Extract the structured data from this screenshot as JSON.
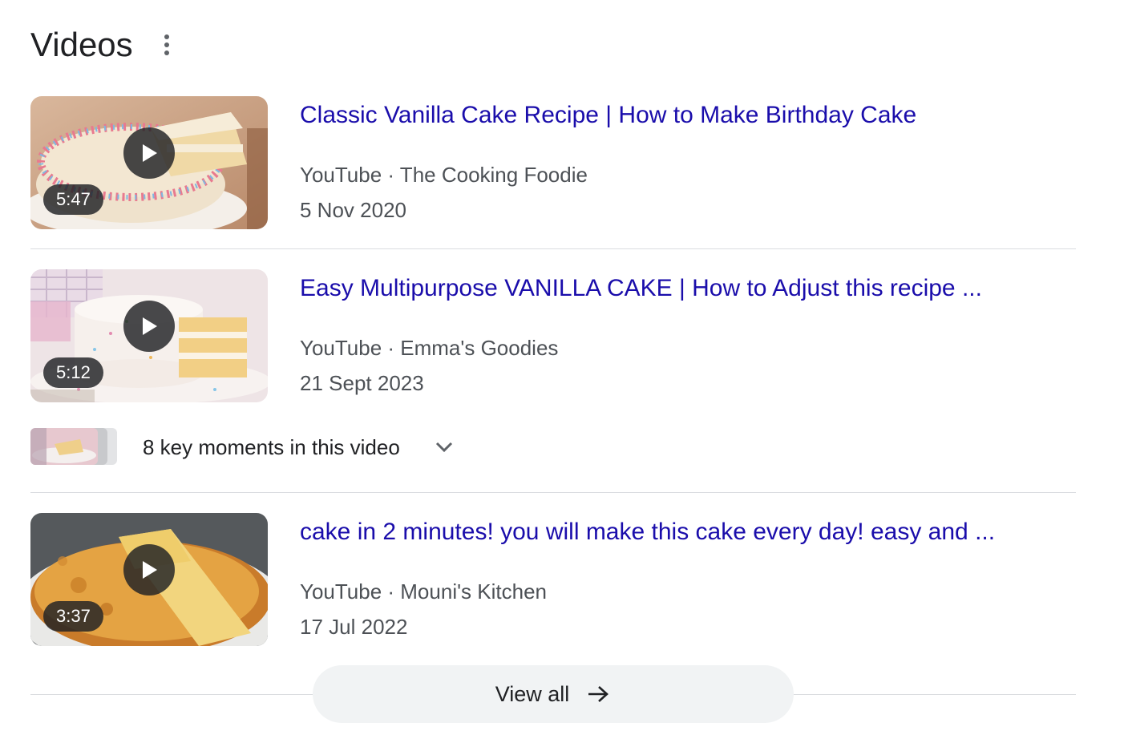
{
  "header": {
    "title": "Videos",
    "menu_icon": "more-vert-icon"
  },
  "videos": [
    {
      "title": "Classic Vanilla Cake Recipe | How to Make Birthday Cake",
      "source": "YouTube · The Cooking Foodie",
      "date": "5 Nov 2020",
      "duration": "5:47"
    },
    {
      "title": "Easy Multipurpose VANILLA CAKE | How to Adjust this recipe ...",
      "source": "YouTube · Emma's Goodies",
      "date": "21 Sept 2023",
      "duration": "5:12"
    },
    {
      "title": "cake in 2 minutes! you will make this cake every day! easy and ...",
      "source": "YouTube · Mouni's Kitchen",
      "date": "17 Jul 2022",
      "duration": "3:37"
    }
  ],
  "key_moments": {
    "label": "8 key moments in this video",
    "icon": "chevron-down-icon"
  },
  "view_all": {
    "label": "View all",
    "icon": "arrow-right-icon"
  },
  "colors": {
    "link": "#1a0dab",
    "meta_text": "#4d5156",
    "divider": "#dadce0",
    "button_bg": "#f1f3f4"
  }
}
